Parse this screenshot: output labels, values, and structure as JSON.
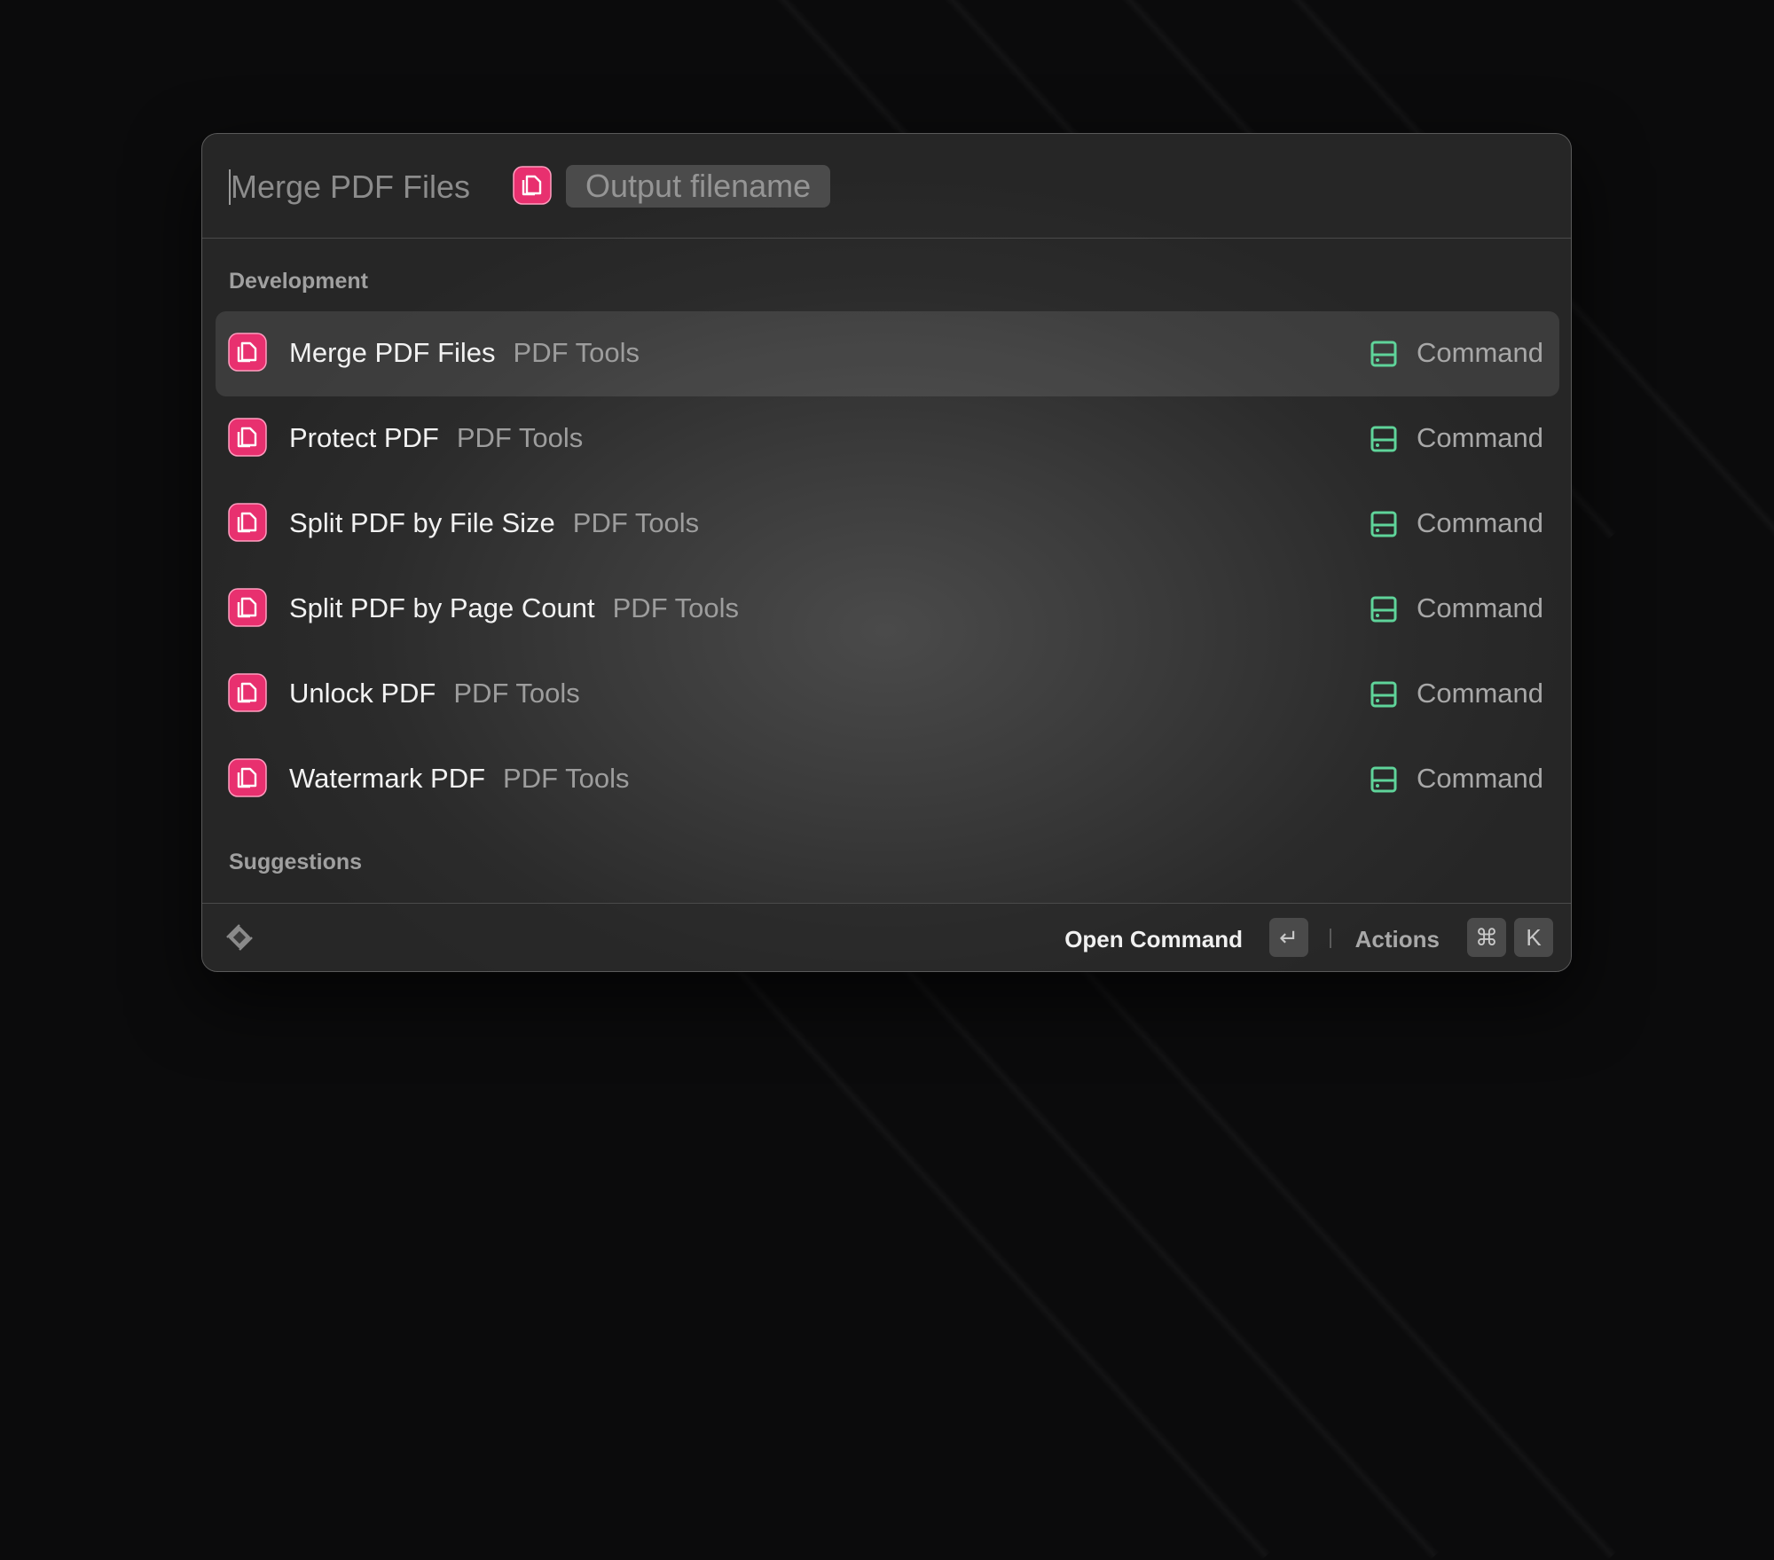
{
  "search": {
    "command_title": "Merge PDF Files",
    "argument_placeholder": "Output filename",
    "icon": "pdf-tools-icon"
  },
  "sections": [
    {
      "title": "Development",
      "items": [
        {
          "title": "Merge PDF Files",
          "subtitle": "PDF Tools",
          "accessory": "Command",
          "icon": "pdf-tools-icon",
          "selected": true
        },
        {
          "title": "Protect PDF",
          "subtitle": "PDF Tools",
          "accessory": "Command",
          "icon": "pdf-tools-icon",
          "selected": false
        },
        {
          "title": "Split PDF by File Size",
          "subtitle": "PDF Tools",
          "accessory": "Command",
          "icon": "pdf-tools-icon",
          "selected": false
        },
        {
          "title": "Split PDF by Page Count",
          "subtitle": "PDF Tools",
          "accessory": "Command",
          "icon": "pdf-tools-icon",
          "selected": false
        },
        {
          "title": "Unlock PDF",
          "subtitle": "PDF Tools",
          "accessory": "Command",
          "icon": "pdf-tools-icon",
          "selected": false
        },
        {
          "title": "Watermark PDF",
          "subtitle": "PDF Tools",
          "accessory": "Command",
          "icon": "pdf-tools-icon",
          "selected": false
        }
      ]
    },
    {
      "title": "Suggestions",
      "items": []
    }
  ],
  "footer": {
    "primary_action": "Open Command",
    "enter_key": "↵",
    "actions_label": "Actions",
    "cmd_key": "⌘",
    "k_key": "K"
  },
  "colors": {
    "icon_pink": "#e8306f",
    "accessory_green": "#5fd49a"
  }
}
